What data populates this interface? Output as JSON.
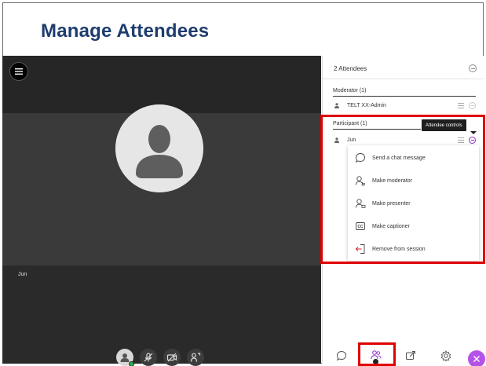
{
  "slide": {
    "title": "Manage Attendees"
  },
  "video": {
    "participant_name": "Jun"
  },
  "panel": {
    "title": "2 Attendees",
    "moderator_group": {
      "label": "Moderator (1)",
      "attendee": "TELT XX-Admin"
    },
    "participant_group": {
      "label": "Participant (1)",
      "attendee": "Jun"
    },
    "tooltip": "Attendee controls",
    "menu": [
      {
        "icon": "chat-bubble-icon",
        "label": "Send a chat message"
      },
      {
        "icon": "make-moderator-icon",
        "label": "Make moderator"
      },
      {
        "icon": "make-presenter-icon",
        "label": "Make presenter"
      },
      {
        "icon": "cc-icon",
        "label": "Make captioner"
      },
      {
        "icon": "remove-session-icon",
        "label": "Remove from session"
      }
    ]
  },
  "colors": {
    "title": "#1e3c6e",
    "accent": "#8b2fc9",
    "highlight": "#e00000",
    "close_button": "#b552e8",
    "stage": "#2d2d2d"
  },
  "media_controls": [
    "my-status-icon",
    "microphone-off-icon",
    "camera-off-icon",
    "share-icon"
  ],
  "tabs": [
    "chat-icon",
    "attendees-icon",
    "share-content-icon",
    "settings-icon",
    "close-icon"
  ]
}
